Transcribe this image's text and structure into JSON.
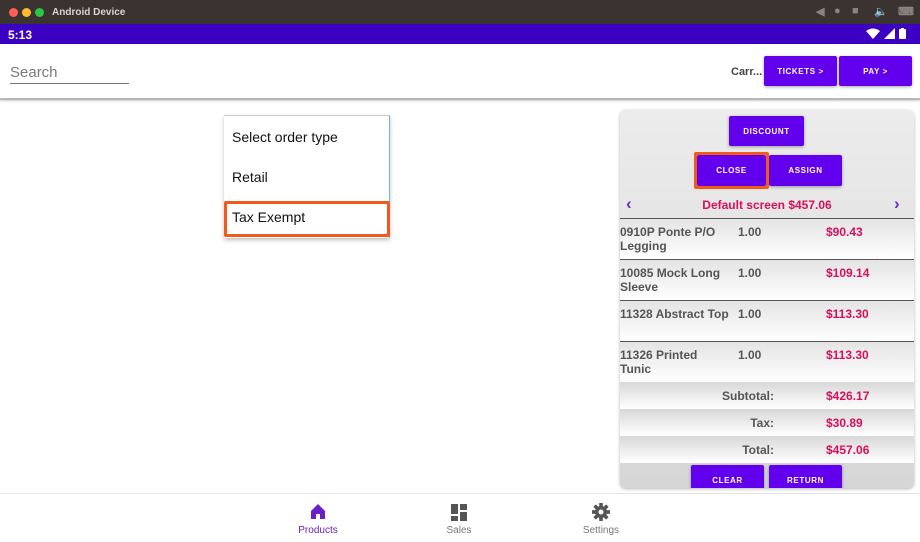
{
  "window": {
    "title": "Android Device"
  },
  "status_bar": {
    "time": "5:13"
  },
  "search": {
    "placeholder": "Search"
  },
  "header": {
    "carrier_label": "Carr...",
    "tickets_label": "TICKETS >",
    "pay_label": "PAY >"
  },
  "order_type_dropdown": {
    "options": [
      "Select order type",
      "Retail",
      "Tax Exempt"
    ],
    "highlighted_option": "Tax Exempt"
  },
  "cart": {
    "discount_label": "DISCOUNT",
    "close_label": "CLOSE",
    "assign_label": "ASSIGN",
    "screen_name": "Default screen $457.06",
    "items": [
      {
        "name": "0910P Ponte P/O Legging",
        "qty": "1.00",
        "price": "$90.43"
      },
      {
        "name": "10085 Mock Long Sleeve",
        "qty": "1.00",
        "price": "$109.14"
      },
      {
        "name": "11328 Abstract Top",
        "qty": "1.00",
        "price": "$113.30"
      },
      {
        "name": "11326 Printed Tunic",
        "qty": "1.00",
        "price": "$113.30"
      }
    ],
    "totals": [
      {
        "label": "Subtotal:",
        "value": "$426.17"
      },
      {
        "label": "Tax:",
        "value": "$30.89"
      },
      {
        "label": "Total:",
        "value": "$457.06"
      }
    ],
    "clear_label": "CLEAR",
    "return_label": "RETURN"
  },
  "bottom_nav": {
    "items": [
      {
        "label": "Products",
        "icon": "home-icon",
        "active": true
      },
      {
        "label": "Sales",
        "icon": "dashboard-icon",
        "active": false
      },
      {
        "label": "Settings",
        "icon": "gear-icon",
        "active": false
      }
    ]
  },
  "colors": {
    "accent": "#6200ee",
    "status_bar": "#3b00c2",
    "price": "#d6105c",
    "highlight": "#f25a1a"
  }
}
